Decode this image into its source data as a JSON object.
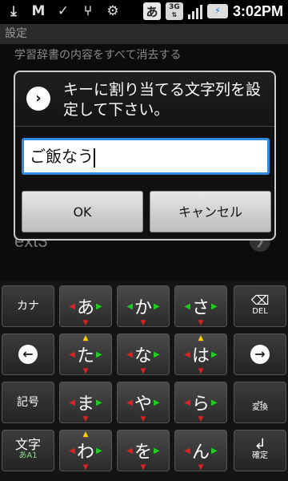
{
  "status_bar": {
    "left_icons": [
      "download-icon",
      "gmail-icon",
      "download-done-icon",
      "usb-icon",
      "android-debug-icon"
    ],
    "ime_char": "あ",
    "network": "3G",
    "time": "3:02PM"
  },
  "background": {
    "screen_title": "設定",
    "row1": "学習辞書の内容をすべて消去する",
    "row2": "ext3"
  },
  "dialog": {
    "title": "キーに割り当てる文字列を設定して下さい。",
    "input_value": "ご飯なう",
    "ok_label": "OK",
    "cancel_label": "キャンセル"
  },
  "keyboard": {
    "left_keys": [
      "カナ",
      "←",
      "記号",
      "文字"
    ],
    "mode_sub": "あA1",
    "right_keys": [
      "DEL",
      "→",
      "変換",
      "確定"
    ],
    "kana_rows": [
      [
        "あ",
        "か",
        "さ"
      ],
      [
        "た",
        "な",
        "は"
      ],
      [
        "ま",
        "や",
        "ら"
      ],
      [
        "わ",
        "を",
        "ん"
      ]
    ]
  }
}
